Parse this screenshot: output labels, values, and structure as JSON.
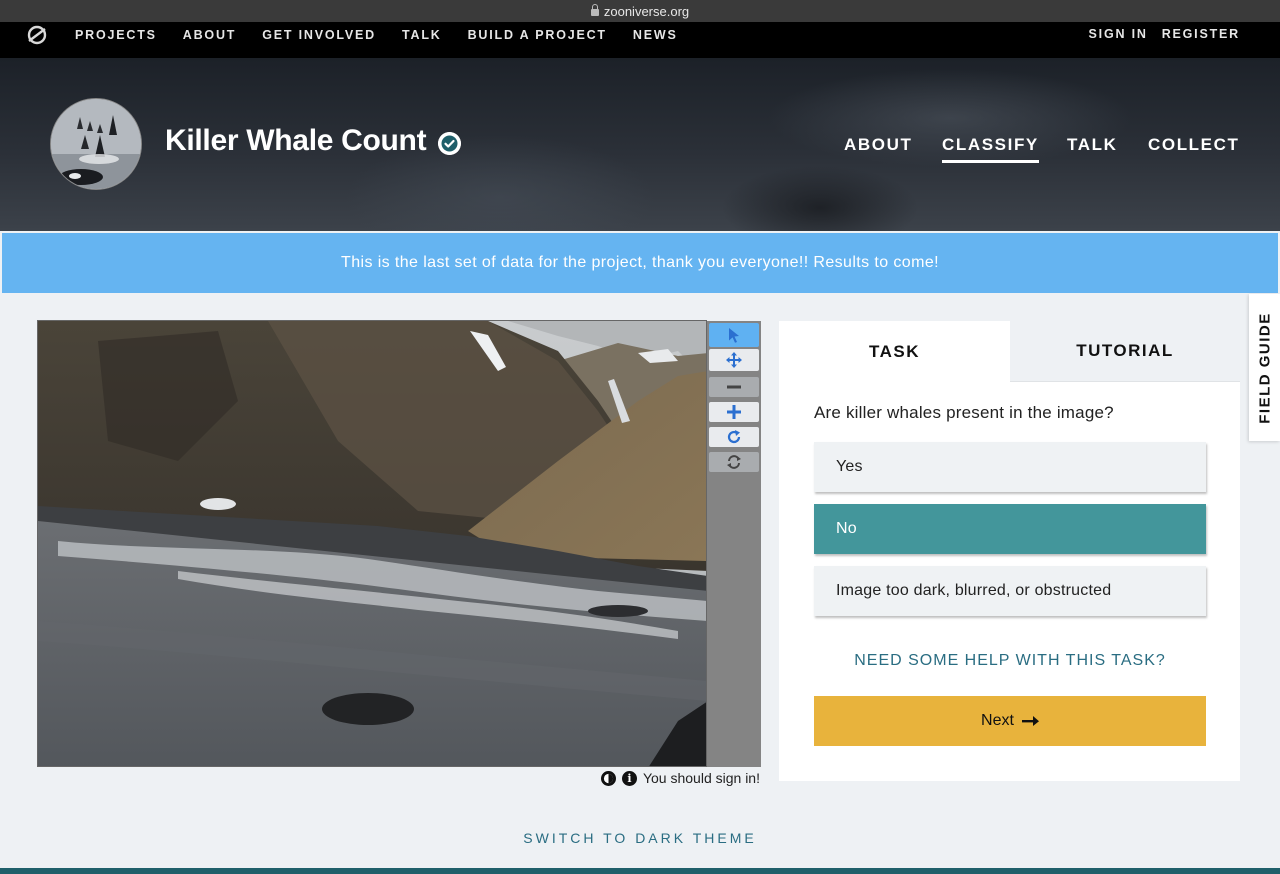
{
  "browser": {
    "url": "zooniverse.org"
  },
  "topnav": {
    "logo_icon": "zooniverse-logo-icon",
    "links": [
      "PROJECTS",
      "ABOUT",
      "GET INVOLVED",
      "TALK",
      "BUILD A PROJECT",
      "NEWS"
    ],
    "sign_in": "SIGN IN",
    "register": "REGISTER"
  },
  "project": {
    "title": "Killer Whale Count",
    "verified_icon": "check-badge-icon",
    "nav": [
      "ABOUT",
      "CLASSIFY",
      "TALK",
      "COLLECT"
    ],
    "active_nav": "CLASSIFY"
  },
  "announcement": "This is the last set of data for the project, thank you everyone!! Results to come!",
  "viewer": {
    "tools": [
      "pointer-icon",
      "pan-icon",
      "zoom-out-icon",
      "zoom-in-icon",
      "rotate-icon",
      "reset-icon"
    ],
    "footer_icons": [
      "invert-icon",
      "info-icon"
    ],
    "footer_text": "You should sign in!"
  },
  "task_panel": {
    "tabs": [
      "TASK",
      "TUTORIAL"
    ],
    "question": "Are killer whales present in the image?",
    "answers": [
      "Yes",
      "No",
      "Image too dark, blurred, or obstructed"
    ],
    "selected_answer": "No",
    "help_link": "NEED SOME HELP WITH THIS TASK?",
    "next_label": "Next",
    "next_icon": "arrow-right-icon"
  },
  "field_guide": "FIELD GUIDE",
  "theme_toggle": "SWITCH TO DARK THEME",
  "colors": {
    "announcement": "#65b4f1",
    "selected_answer": "#43969b",
    "next_button": "#e8b33c",
    "link": "#2a6d82",
    "active_tool": "#5fb1f2"
  }
}
